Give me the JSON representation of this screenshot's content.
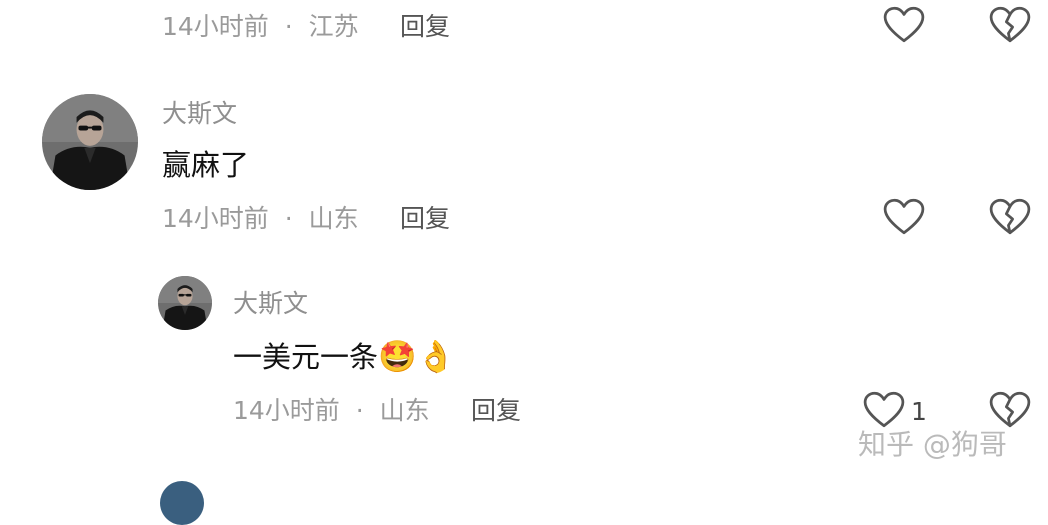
{
  "comments": [
    {
      "time": "14小时前",
      "location": "江苏",
      "reply_label": "回复"
    },
    {
      "username": "大斯文",
      "text": "赢麻了",
      "time": "14小时前",
      "location": "山东",
      "reply_label": "回复"
    },
    {
      "username": "大斯文",
      "text": "一美元一条",
      "emojis": [
        "🤩",
        "👌"
      ],
      "time": "14小时前",
      "location": "山东",
      "reply_label": "回复",
      "like_count": "1"
    }
  ],
  "separator": "·",
  "watermark": "知乎 @狗哥",
  "colors": {
    "meta": "#9a9a9a",
    "text": "#111111",
    "icon": "#555555"
  },
  "icons": [
    "heart-outline-icon",
    "broken-heart-icon"
  ]
}
